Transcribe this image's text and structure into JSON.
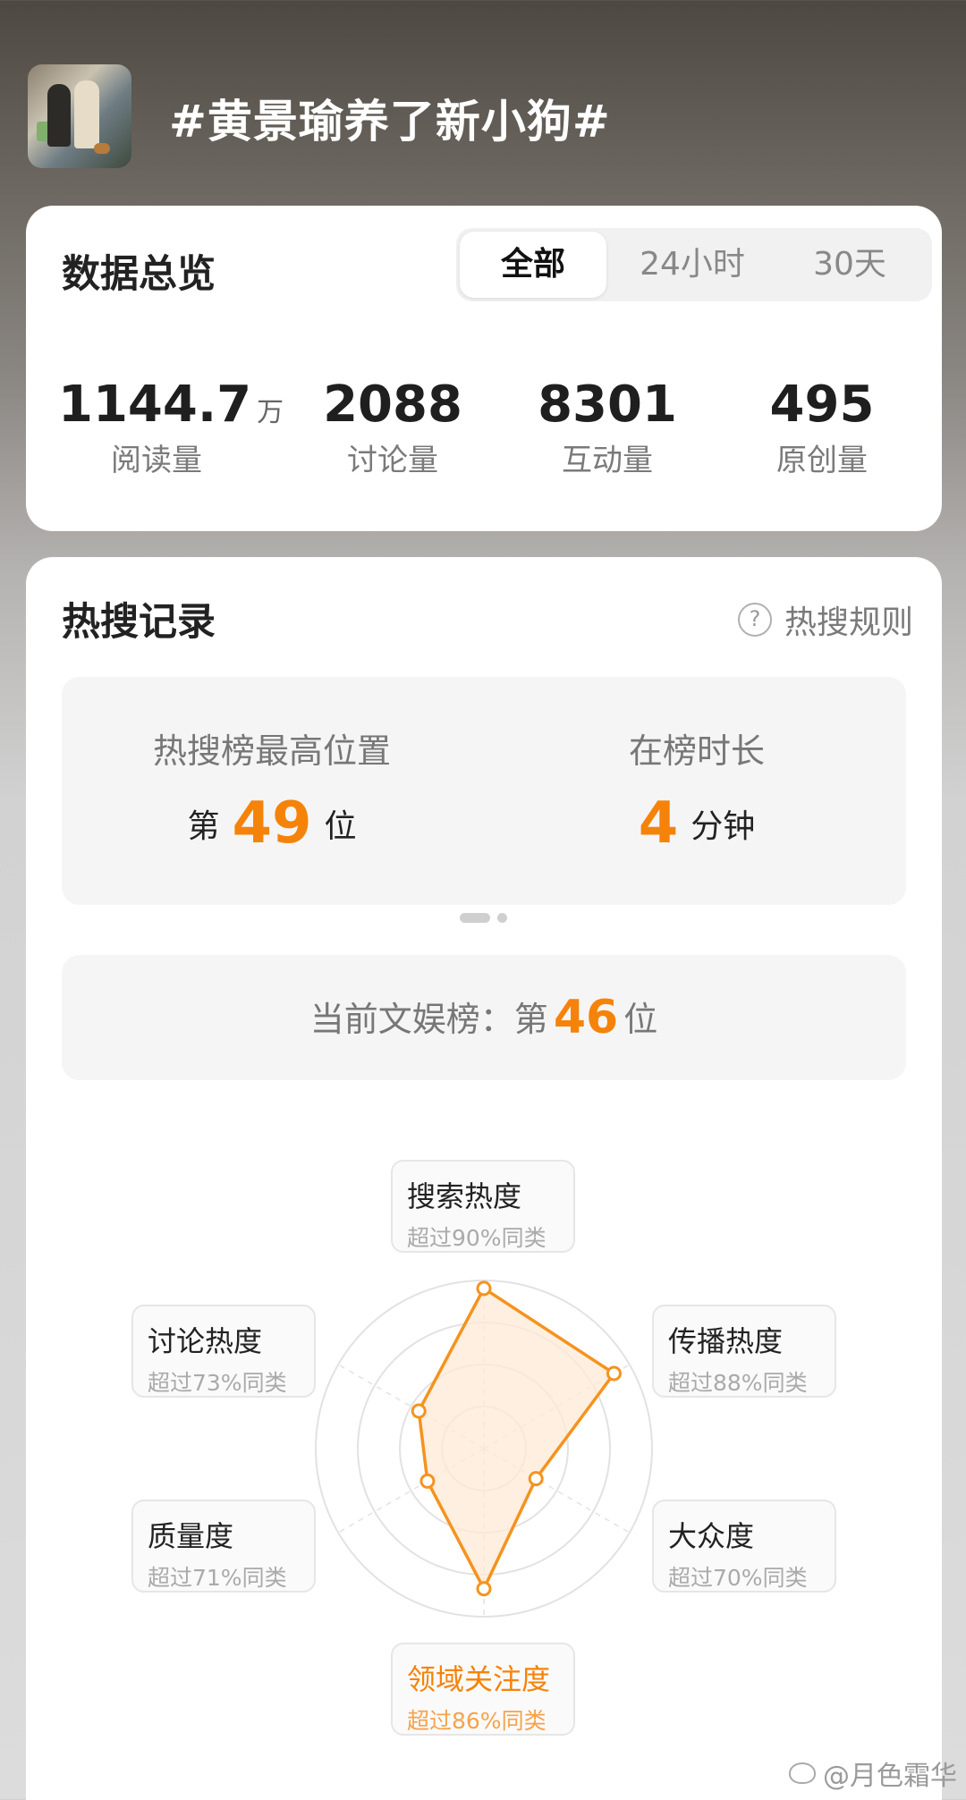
{
  "topic": {
    "title": "#黄景瑜养了新小狗#"
  },
  "overview": {
    "title": "数据总览",
    "tabs": [
      {
        "label": "全部",
        "active": true
      },
      {
        "label": "24小时",
        "active": false
      },
      {
        "label": "30天",
        "active": false
      }
    ],
    "stats": [
      {
        "value": "1144.7",
        "unit": "万",
        "label": "阅读量"
      },
      {
        "value": "2088",
        "unit": "",
        "label": "讨论量"
      },
      {
        "value": "8301",
        "unit": "",
        "label": "互动量"
      },
      {
        "value": "495",
        "unit": "",
        "label": "原创量"
      }
    ]
  },
  "hot": {
    "title": "热搜记录",
    "rules_label": "热搜规则",
    "peak": {
      "title": "热搜榜最高位置",
      "prefix": "第",
      "value": "49",
      "suffix": "位"
    },
    "duration": {
      "title": "在榜时长",
      "value": "4",
      "suffix": "分钟"
    },
    "current": {
      "label": "当前文娱榜：第",
      "value": "46",
      "suffix": "位"
    },
    "radar": {
      "axes": [
        {
          "name": "搜索热度",
          "percent_text": "超过90%同类",
          "value": 90
        },
        {
          "name": "传播热度",
          "percent_text": "超过88%同类",
          "value": 88
        },
        {
          "name": "大众度",
          "percent_text": "超过70%同类",
          "value": 70
        },
        {
          "name": "领域关注度",
          "percent_text": "超过86%同类",
          "value": 86,
          "highlight": true
        },
        {
          "name": "质量度",
          "percent_text": "超过71%同类",
          "value": 71
        },
        {
          "name": "讨论热度",
          "percent_text": "超过73%同类",
          "value": 73
        }
      ],
      "colors": {
        "line": "#f5931e",
        "fill": "#fde9d6",
        "grid": "#e2e2e2"
      }
    }
  },
  "watermark": {
    "text": "@月色霜华"
  }
}
